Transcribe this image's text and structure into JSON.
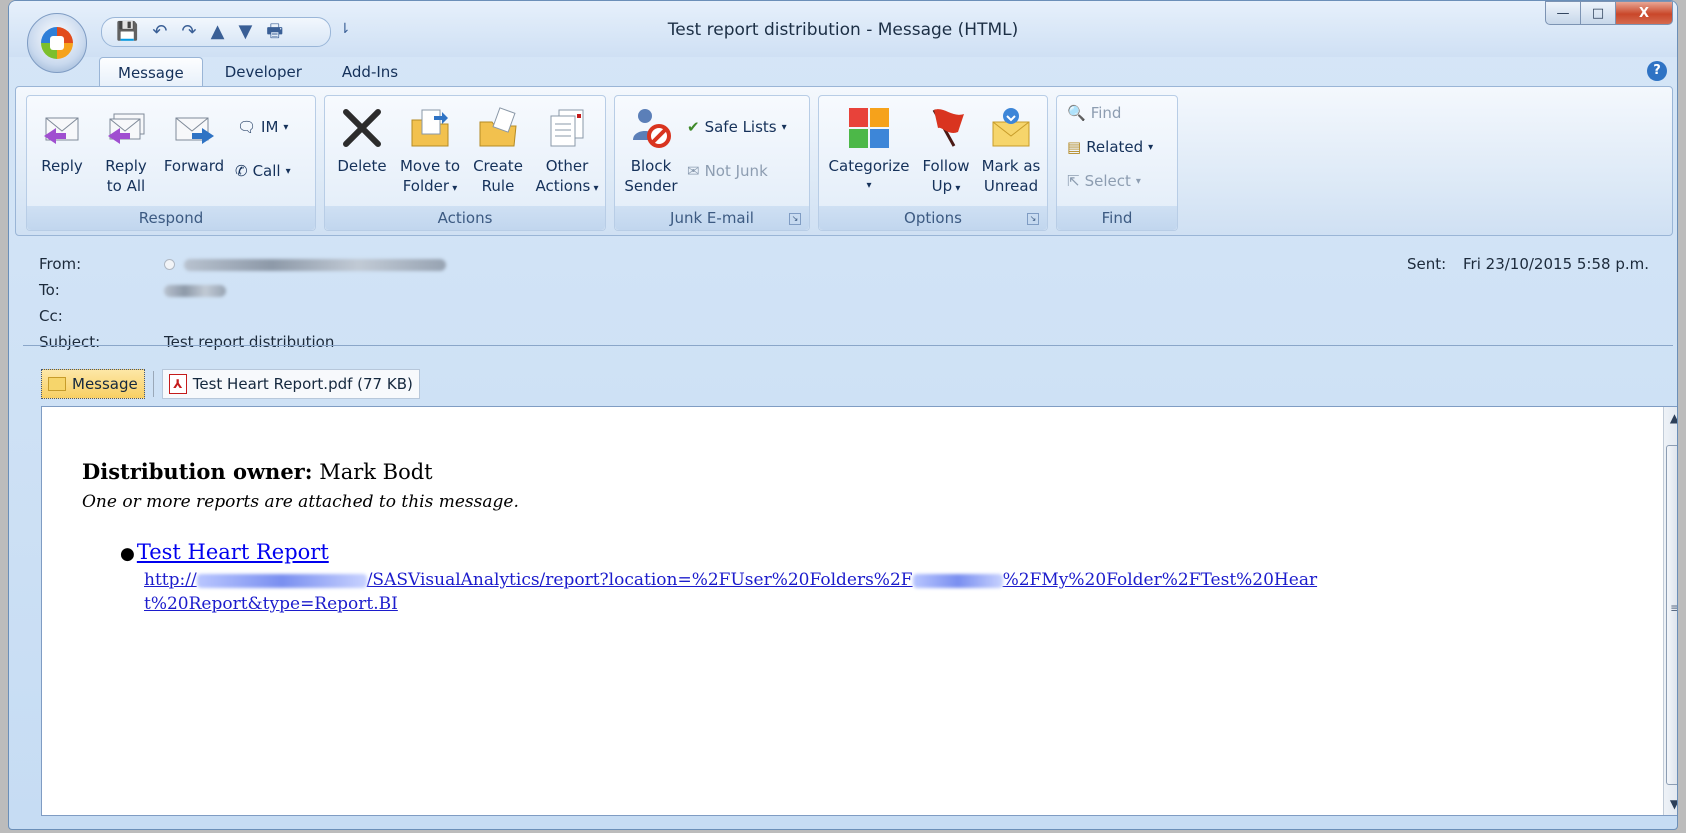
{
  "window": {
    "title": "Test report distribution - Message (HTML)",
    "controls": {
      "minimize": "—",
      "maximize": "□",
      "close": "X"
    }
  },
  "qat": {
    "more": "⇂"
  },
  "tabs": [
    {
      "label": "Message"
    },
    {
      "label": "Developer"
    },
    {
      "label": "Add-Ins"
    }
  ],
  "help": "?",
  "ribbon": {
    "respond": {
      "label": "Respond",
      "reply": "Reply",
      "reply_all_1": "Reply",
      "reply_all_2": "to All",
      "forward": "Forward",
      "im": "IM",
      "call": "Call"
    },
    "actions": {
      "label": "Actions",
      "delete": "Delete",
      "move_1": "Move to",
      "move_2": "Folder",
      "create_1": "Create",
      "create_2": "Rule",
      "other_1": "Other",
      "other_2": "Actions"
    },
    "junk": {
      "label": "Junk E-mail",
      "block_1": "Block",
      "block_2": "Sender",
      "safe_lists": "Safe Lists",
      "not_junk": "Not Junk"
    },
    "options": {
      "label": "Options",
      "categorize": "Categorize",
      "follow_1": "Follow",
      "follow_2": "Up",
      "mark_1": "Mark as",
      "mark_2": "Unread"
    },
    "find": {
      "label": "Find",
      "find": "Find",
      "related": "Related",
      "select": "Select"
    }
  },
  "header": {
    "from_label": "From:",
    "to_label": "To:",
    "cc_label": "Cc:",
    "subject_label": "Subject:",
    "subject": "Test report distribution",
    "sent_label": "Sent:",
    "sent": "Fri 23/10/2015 5:58 p.m."
  },
  "attachments": [
    {
      "label": "Message"
    },
    {
      "label": "Test Heart Report.pdf (77 KB)"
    }
  ],
  "body": {
    "owner_label": "Distribution owner:",
    "owner_name": "Mark Bodt",
    "note": "One or more reports are attached to this message.",
    "report_link": "Test Heart Report",
    "url_prefix": "http://",
    "url_mid": "/SASVisualAnalytics/report?location=%2FUser%20Folders%2F",
    "url_end": "%2FMy%20Folder%2FTest%20Heart%20Report&type=Report.BI"
  },
  "icons": {
    "office": "office-logo-icon",
    "pdf": "pdf-icon",
    "message": "envelope-icon"
  }
}
